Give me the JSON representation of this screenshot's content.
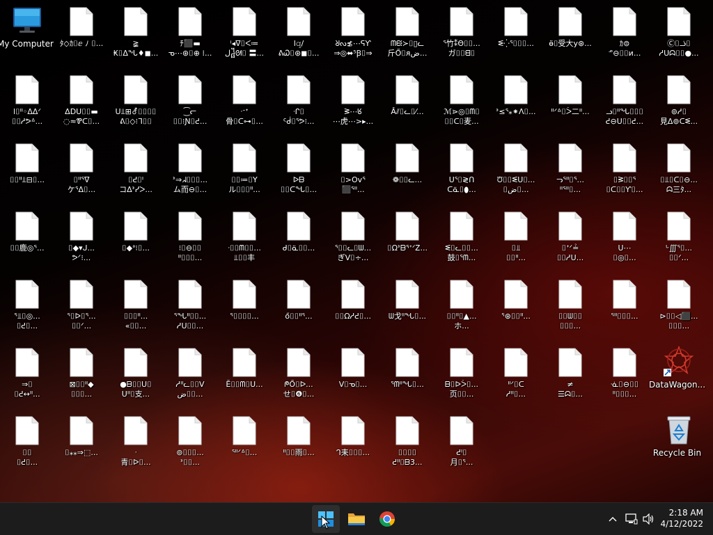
{
  "desktop": {
    "my_computer": "My Computer",
    "datawagon": "DataWagon...",
    "recycle_bin": "Recycle Bin",
    "files": [
      [
        "ﾀ◇ｶ⌷ⅇ ﾉ ⌷...",
        "≷\nℹ⌷ᘮ〓●..."
      ],
      [
        "≩\n₭⌷ᐃᖓ♦◼..."
      ],
      [
        "ﾁ⬛▬\nᓀ⋯⊛⌷⊕ ⁞..."
      ],
      [
        "ⁱ◂ᐁ⌷ᐸ≔\nل᧸ᘛ⌷ 〓..."
      ],
      [
        "ⅼ𝚚/\nᕕᏇ⌷⊛◼⌷..."
      ],
      [
        "ᖈᔓ≴⋯ᕋƳ\n⇒◎⬌⁵Ꞵ⌷⇒"
      ],
      [
        "ᗰᙦ≻⌷▯ᓚ\n斤Ő⌷ᴙض..."
      ],
      [
        "ᕐ竹⁑Θ⌷⌷...\nガ⌷⌷ᗺ⌷"
      ],
      [
        "ᓬ⁛ᕐ⌷⌷⌷..."
      ],
      [
        "ӫ⌷受大y⊛..."
      ],
      [
        "ｶ⊜\nᓒ⊖⌷⌷ᴎ..."
      ],
      [
        "Ⓒ⌷ᓘ⌷\nᓱᑌᗣ⌷⌷●..."
      ],
      [
        "ⅼ⌷ᐦ◦ᐃᐃᐟ\n⌷⌷ᓱᕗᐞ..."
      ],
      [
        "ᐃⅮᑌ⌷⌷▬\n◌≈Ꮘᑕ⌷..."
      ],
      [
        "ᑌ⫫⊞⚦⌷⌷⌷⌷\nᕕ⌷◇⁝ᒣ⌷⌷"
      ],
      [
        "⁐ᓕ\n⌷⌷⁝Ɲ⌷ᕍ..."
      ],
      [
        "ᐧᐨᐩ\n骨⌷ᑕ⊶⌷..."
      ],
      [
        "ᐧᒋ⌷\nᑦᑰ⌷ᕐᕗ⁝..."
      ],
      [
        "ᕒ⋯ᖉ\n⋯虎⋯>▸..."
      ],
      [
        "Ấ⫽⌷ᓚ⌷⁄..."
      ],
      [
        "ℳ⋗◎⌷ᗰ⌷\n⌷⌷ᑕ⌷麦..."
      ],
      [
        "ᕑ≤ᕐ⁎⁕ᐱ⌷..."
      ],
      [
        "ᐦᐟᐞ⌷ᐴ二ᐦ..."
      ],
      [
        "ᓗ⌷ᐦᖓ⌷⌷⌷\nᕍ⊖ᑌ⌷⌷ᕍ..."
      ],
      [
        "⊚ᓱ⌷\n見ᐃ⊚ᑕᓬ..."
      ],
      [
        "⌷⌷ᐦ⫫⊟⌷..."
      ],
      [
        "⌷ᑊᑊᕐᐁ\nケᕐᐃ⌷..."
      ],
      [
        "⌷ᕍ⌷ᑊ\nコᐃᕑᓯᐳ..."
      ],
      [
        "ᕑ⇒ᖽ⌷⌷⌷...\nム而⊖⌷..."
      ],
      [
        "⌷⌷≔⌷Y\nル⌷⌷⌷ᐦ..."
      ],
      [
        "ᐅᗷ\n⌷⌷ᑕᖓ⌷..."
      ],
      [
        "⌷>Ovᕐ\n⬛ᕐᐦ..."
      ],
      [
        "❁⌷⌷ᓚ..."
      ],
      [
        "ᑌᕐ⌷≷ᑎ\nᑕᓏ⌷⬮..."
      ],
      [
        "ᙈ⌷⌷ᓬᑌ⌷...\n⌷ض⌷..."
      ],
      [
        "ᓓᕐᐦ⌷ᕐ...\nᐦᕐᐦ⌷..."
      ],
      [
        "⌷ᕒ⌷⌷ᕐ\n⌷ᑕ⌷⌷Ƴ⌷..."
      ],
      [
        "⌷⫫⌷ᑕ⌷⊖...\nᗣ三ﾀ..."
      ],
      [
        "⌷⌷鹿◎ᕐ...\n"
      ],
      [
        "⌷◆▾ᒍ...\nᕗᐟ⁝..."
      ],
      [
        "⌷◆ᐤ⁝⌷..."
      ],
      [
        "⁝⌷⊖⌷⌷\nᐦ⌷⌷⌷..."
      ],
      [
        "ᐧ⌷⌷ᗰ⌷⌷...\n⫫⌷⌷丰"
      ],
      [
        "ᑯ⌷ᓏ⌷⌷..."
      ],
      [
        "ᕐ⌷⌷ᓚ⌷ᗯ...\nぎᐯ⌷÷..."
      ],
      [
        "⌷ΩᕑᗷᕐᐩᐟᏃ..."
      ],
      [
        "ᓬ⌷ᓚ⌷⌷...\n鼓⌷ᕐᗰ..."
      ],
      [
        "⌷⫫\n⌷⌷ᐦ..."
      ],
      [
        "⌷ᐩᐟ≟\n⌷⌷ᓱᑌ..."
      ],
      [
        "ᑌ⋯\n⌷◎⌷..."
      ],
      [
        "ᒡ∭ᕐ⌷...\n⌷⌷ᐟ..."
      ],
      [
        "ᕐ⫫⌷◎...\n⌷ᕍ⌷..."
      ],
      [
        "ᕐ⌷ᐅ⌷ᕐ...\n⌷⌷ᐟ..."
      ],
      [
        "⌷⌷⌷ᐦ...\n«⌷⌷..."
      ],
      [
        "ᕐᖓᐦ⌷⌷...\nᓱᑌ⌷⌷..."
      ],
      [
        "ᕐ⌷⌷⌷⌷..."
      ],
      [
        "ő⌷⌷ᐦᕐ..."
      ],
      [
        "⌷⌷Ωᓱᕍ⌷..."
      ],
      [
        "ᗯ戈ᐦᖓ⌷..."
      ],
      [
        "⌷⌷ᐦ⌷▲...\nホ..."
      ],
      [
        "ᕐ⊛⌷⌷ᐦ..."
      ],
      [
        "⌷⌷ᗯ⌷⌷\n⌷⌷⌷..."
      ],
      [
        "ᕐᐦ⌷⌷⌷..."
      ],
      [
        "⊳⌷⌷◁⬛...\n⌷⌷⌷..."
      ],
      [
        "⇒⌷\n⌷ᕍ↔ᐦ..."
      ],
      [
        "⊠⌷⌷ᐦ◆\n⌷⌷⌷..."
      ],
      [
        "●ᗷ⌷⌷ᑌ⌷\nᑌᐦ⌷支..."
      ],
      [
        "ᓱᐦᓚ⌷⌷ᐯ\nض⌷⌷..."
      ],
      [
        "Ĕ⌷⌷ᗰ⌷ᑌ..."
      ],
      [
        "ᖘŐ⌷ᐅ...\nせ⌷❻⌷..."
      ],
      [
        "ᐯ⌷ᓀ⌷..."
      ],
      [
        "ᕐᗰᐦᖓ⌷..."
      ],
      [
        "ᗷ⌷ᐅᐴ⌷...\n页⌷⌷..."
      ],
      [
        "ᐦᐟ⌷ᑕ\nᓱᐦ⌷..."
      ],
      [
        "≠\n☰ᗣ⌷..."
      ],
      [
        "ᓍ⌷⊖⌷⌷\nᐦ⌷⌷⌷..."
      ],
      [
        "⌷⌷\n⌷ᕍ⌷..."
      ],
      [
        "⌷⁎⁎⇒⬚..."
      ],
      [
        "ᐧ\n青⌷ᐅ⌷..."
      ],
      [
        "⊚⌷⌷⌷...\nᕑ⌷⌷..."
      ],
      [
        "ᕐᐦᐟᐞ⌷..."
      ],
      [
        "ᐦ⌷⌷雨⌷..."
      ],
      [
        "ᒉ耒⌷⌷⌷..."
      ],
      [
        "⌷⌷⌷⌷\nᕍᐦ⌷ᗷ3..."
      ],
      [
        "ᕍᑊ⌷\n月⌷ᕐ..."
      ]
    ]
  },
  "taskbar": {
    "time": "2:18 AM",
    "date": "4/12/2022"
  }
}
